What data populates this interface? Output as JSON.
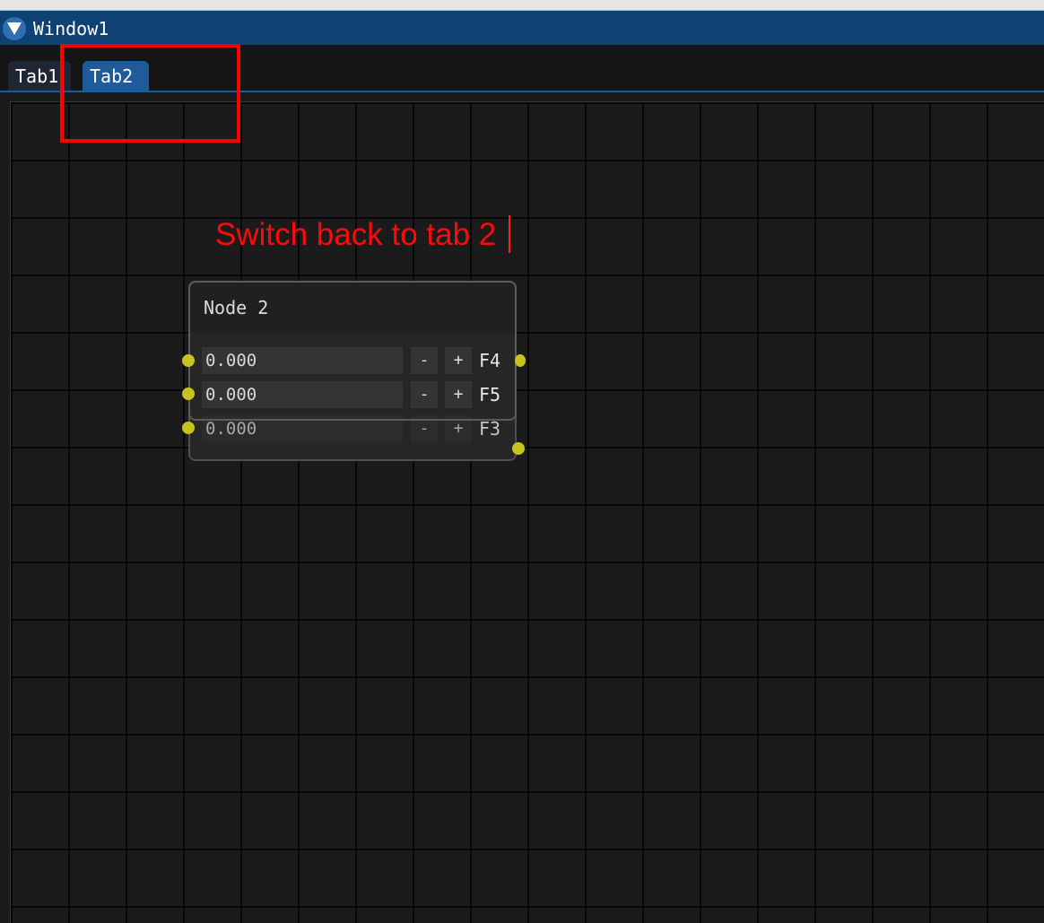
{
  "window": {
    "title": "Window1"
  },
  "tabs": [
    {
      "label": "Tab1",
      "active": false
    },
    {
      "label": "Tab2",
      "active": true
    }
  ],
  "annotation": {
    "text": "Switch back to tab 2",
    "color": "#ff0a0a"
  },
  "node": {
    "title": "Node 2",
    "rows": [
      {
        "value": "0.000",
        "minus": "-",
        "plus": "+",
        "label": "F4"
      },
      {
        "value": "0.000",
        "minus": "-",
        "plus": "+",
        "label": "F5"
      },
      {
        "value": "0.000",
        "minus": "-",
        "plus": "+",
        "label": "F3"
      }
    ]
  },
  "colors": {
    "titlebar": "#0f4274",
    "tab_active": "#1f5b98",
    "pin": "#c6c41c",
    "highlight": "#ff0000"
  }
}
